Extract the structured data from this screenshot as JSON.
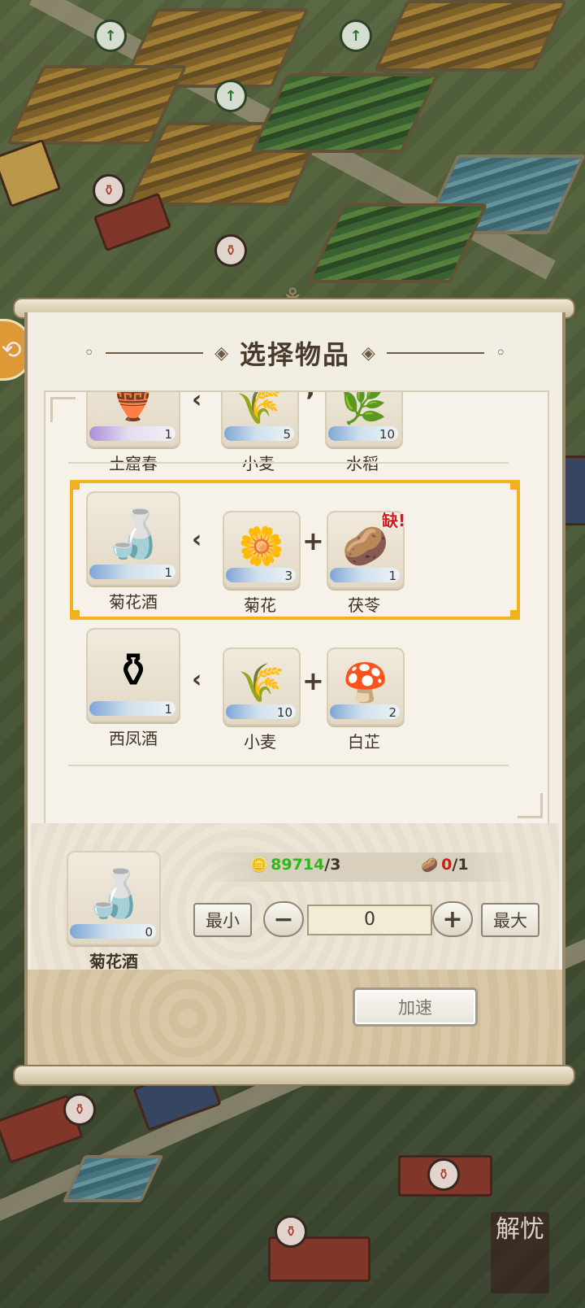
{
  "dialog": {
    "title": "选择物品",
    "recipes": [
      {
        "product": {
          "name": "土窟春",
          "count": "1",
          "icon": "wine-jar-icon"
        },
        "ingredients": [
          {
            "name": "小麦",
            "count": "5",
            "icon": "wheat-icon"
          },
          {
            "name": "水稻",
            "count": "10",
            "icon": "rice-icon"
          }
        ]
      },
      {
        "product": {
          "name": "菊花酒",
          "count": "1",
          "icon": "chrysanthemum-wine-icon"
        },
        "ingredients": [
          {
            "name": "菊花",
            "count": "3",
            "icon": "chrysanthemum-icon"
          },
          {
            "name": "茯苓",
            "count": "1",
            "icon": "poria-icon",
            "badge": "缺!"
          }
        ],
        "selected": true
      },
      {
        "product": {
          "name": "西凤酒",
          "count": "1",
          "icon": "xifeng-wine-icon"
        },
        "ingredients": [
          {
            "name": "小麦",
            "count": "10",
            "icon": "wheat-icon"
          },
          {
            "name": "白芷",
            "count": "2",
            "icon": "angelica-icon"
          }
        ]
      }
    ],
    "craft": {
      "item_name": "菊花酒",
      "item_count": "0",
      "resource1_have": "89714",
      "resource1_need": "/3",
      "resource2_have": "0",
      "resource2_need": "/1",
      "min_label": "最小",
      "max_label": "最大",
      "minus_label": "−",
      "plus_label": "+",
      "quantity": "0"
    },
    "speed_label": "加速"
  },
  "colors": {
    "highlight": "#f2b01b",
    "ok": "#2fb81c",
    "lack": "#c8201a"
  },
  "corner_seal": "解忧"
}
